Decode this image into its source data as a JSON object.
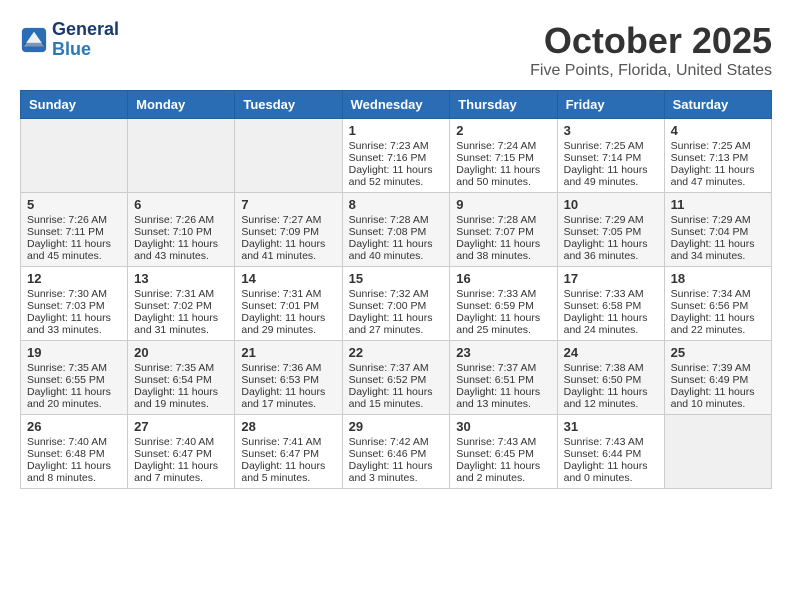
{
  "header": {
    "logo_line1": "General",
    "logo_line2": "Blue",
    "month": "October 2025",
    "location": "Five Points, Florida, United States"
  },
  "weekdays": [
    "Sunday",
    "Monday",
    "Tuesday",
    "Wednesday",
    "Thursday",
    "Friday",
    "Saturday"
  ],
  "weeks": [
    [
      {
        "day": "",
        "content": ""
      },
      {
        "day": "",
        "content": ""
      },
      {
        "day": "",
        "content": ""
      },
      {
        "day": "1",
        "content": "Sunrise: 7:23 AM\nSunset: 7:16 PM\nDaylight: 11 hours\nand 52 minutes."
      },
      {
        "day": "2",
        "content": "Sunrise: 7:24 AM\nSunset: 7:15 PM\nDaylight: 11 hours\nand 50 minutes."
      },
      {
        "day": "3",
        "content": "Sunrise: 7:25 AM\nSunset: 7:14 PM\nDaylight: 11 hours\nand 49 minutes."
      },
      {
        "day": "4",
        "content": "Sunrise: 7:25 AM\nSunset: 7:13 PM\nDaylight: 11 hours\nand 47 minutes."
      }
    ],
    [
      {
        "day": "5",
        "content": "Sunrise: 7:26 AM\nSunset: 7:11 PM\nDaylight: 11 hours\nand 45 minutes."
      },
      {
        "day": "6",
        "content": "Sunrise: 7:26 AM\nSunset: 7:10 PM\nDaylight: 11 hours\nand 43 minutes."
      },
      {
        "day": "7",
        "content": "Sunrise: 7:27 AM\nSunset: 7:09 PM\nDaylight: 11 hours\nand 41 minutes."
      },
      {
        "day": "8",
        "content": "Sunrise: 7:28 AM\nSunset: 7:08 PM\nDaylight: 11 hours\nand 40 minutes."
      },
      {
        "day": "9",
        "content": "Sunrise: 7:28 AM\nSunset: 7:07 PM\nDaylight: 11 hours\nand 38 minutes."
      },
      {
        "day": "10",
        "content": "Sunrise: 7:29 AM\nSunset: 7:05 PM\nDaylight: 11 hours\nand 36 minutes."
      },
      {
        "day": "11",
        "content": "Sunrise: 7:29 AM\nSunset: 7:04 PM\nDaylight: 11 hours\nand 34 minutes."
      }
    ],
    [
      {
        "day": "12",
        "content": "Sunrise: 7:30 AM\nSunset: 7:03 PM\nDaylight: 11 hours\nand 33 minutes."
      },
      {
        "day": "13",
        "content": "Sunrise: 7:31 AM\nSunset: 7:02 PM\nDaylight: 11 hours\nand 31 minutes."
      },
      {
        "day": "14",
        "content": "Sunrise: 7:31 AM\nSunset: 7:01 PM\nDaylight: 11 hours\nand 29 minutes."
      },
      {
        "day": "15",
        "content": "Sunrise: 7:32 AM\nSunset: 7:00 PM\nDaylight: 11 hours\nand 27 minutes."
      },
      {
        "day": "16",
        "content": "Sunrise: 7:33 AM\nSunset: 6:59 PM\nDaylight: 11 hours\nand 25 minutes."
      },
      {
        "day": "17",
        "content": "Sunrise: 7:33 AM\nSunset: 6:58 PM\nDaylight: 11 hours\nand 24 minutes."
      },
      {
        "day": "18",
        "content": "Sunrise: 7:34 AM\nSunset: 6:56 PM\nDaylight: 11 hours\nand 22 minutes."
      }
    ],
    [
      {
        "day": "19",
        "content": "Sunrise: 7:35 AM\nSunset: 6:55 PM\nDaylight: 11 hours\nand 20 minutes."
      },
      {
        "day": "20",
        "content": "Sunrise: 7:35 AM\nSunset: 6:54 PM\nDaylight: 11 hours\nand 19 minutes."
      },
      {
        "day": "21",
        "content": "Sunrise: 7:36 AM\nSunset: 6:53 PM\nDaylight: 11 hours\nand 17 minutes."
      },
      {
        "day": "22",
        "content": "Sunrise: 7:37 AM\nSunset: 6:52 PM\nDaylight: 11 hours\nand 15 minutes."
      },
      {
        "day": "23",
        "content": "Sunrise: 7:37 AM\nSunset: 6:51 PM\nDaylight: 11 hours\nand 13 minutes."
      },
      {
        "day": "24",
        "content": "Sunrise: 7:38 AM\nSunset: 6:50 PM\nDaylight: 11 hours\nand 12 minutes."
      },
      {
        "day": "25",
        "content": "Sunrise: 7:39 AM\nSunset: 6:49 PM\nDaylight: 11 hours\nand 10 minutes."
      }
    ],
    [
      {
        "day": "26",
        "content": "Sunrise: 7:40 AM\nSunset: 6:48 PM\nDaylight: 11 hours\nand 8 minutes."
      },
      {
        "day": "27",
        "content": "Sunrise: 7:40 AM\nSunset: 6:47 PM\nDaylight: 11 hours\nand 7 minutes."
      },
      {
        "day": "28",
        "content": "Sunrise: 7:41 AM\nSunset: 6:47 PM\nDaylight: 11 hours\nand 5 minutes."
      },
      {
        "day": "29",
        "content": "Sunrise: 7:42 AM\nSunset: 6:46 PM\nDaylight: 11 hours\nand 3 minutes."
      },
      {
        "day": "30",
        "content": "Sunrise: 7:43 AM\nSunset: 6:45 PM\nDaylight: 11 hours\nand 2 minutes."
      },
      {
        "day": "31",
        "content": "Sunrise: 7:43 AM\nSunset: 6:44 PM\nDaylight: 11 hours\nand 0 minutes."
      },
      {
        "day": "",
        "content": ""
      }
    ]
  ]
}
